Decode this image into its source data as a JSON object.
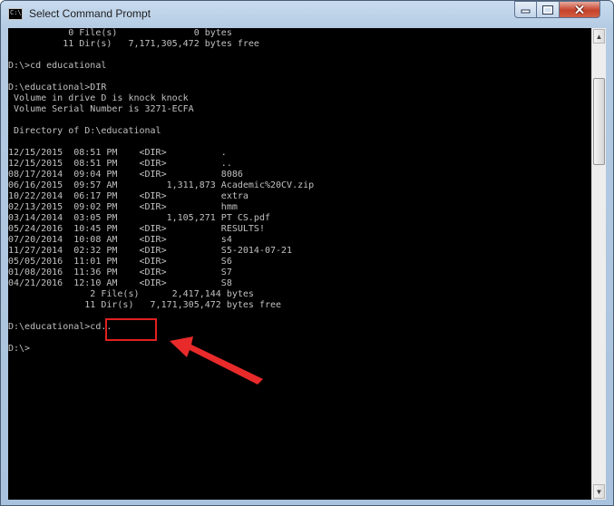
{
  "window": {
    "title": "Select Command Prompt",
    "icon_label": "C:\\",
    "controls": [
      "minimize-icon",
      "maximize-icon",
      "close-icon"
    ],
    "colors": {
      "console_bg": "#000000",
      "console_text": "#c0c0c0",
      "annotation": "#e02020"
    }
  },
  "console": {
    "lines": [
      "           0 File(s)              0 bytes",
      "          11 Dir(s)   7,171,305,472 bytes free",
      "",
      "D:\\>cd educational",
      "",
      "D:\\educational>DIR",
      " Volume in drive D is knock knock",
      " Volume Serial Number is 3271-ECFA",
      "",
      " Directory of D:\\educational",
      "",
      "12/15/2015  08:51 PM    <DIR>          .",
      "12/15/2015  08:51 PM    <DIR>          ..",
      "08/17/2014  09:04 PM    <DIR>          8086",
      "06/16/2015  09:57 AM         1,311,873 Academic%20CV.zip",
      "10/22/2014  06:17 PM    <DIR>          extra",
      "02/13/2015  09:02 PM    <DIR>          hmm",
      "03/14/2014  03:05 PM         1,105,271 PT CS.pdf",
      "05/24/2016  10:45 PM    <DIR>          RESULTS!",
      "07/20/2014  10:08 AM    <DIR>          s4",
      "11/27/2014  02:32 PM    <DIR>          S5-2014-07-21",
      "05/05/2016  11:01 PM    <DIR>          S6",
      "01/08/2016  11:36 PM    <DIR>          S7",
      "04/21/2016  12:10 AM    <DIR>          S8",
      "               2 File(s)      2,417,144 bytes",
      "              11 Dir(s)   7,171,305,472 bytes free",
      "",
      "D:\\educational>cd..",
      "",
      "D:\\>"
    ]
  }
}
